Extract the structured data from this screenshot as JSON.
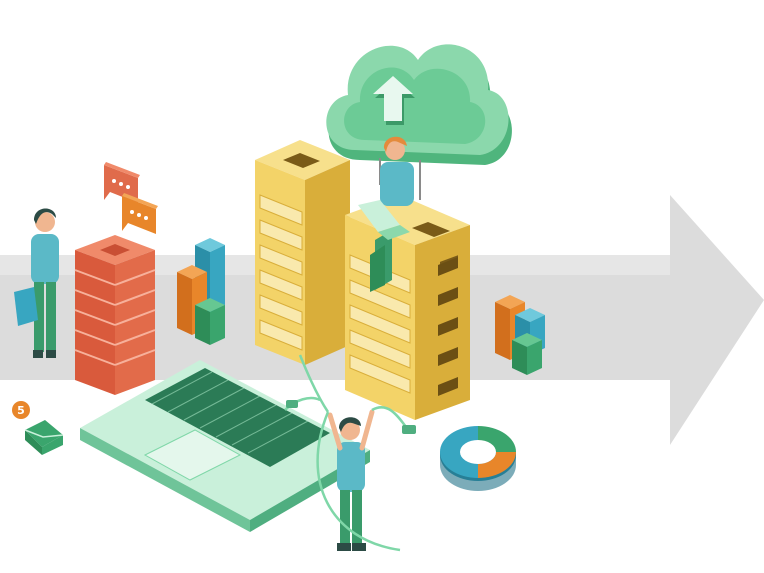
{
  "illustration": {
    "theme": "cloud data transfer isometric illustration",
    "notification_badge": "5",
    "palette": {
      "background": "#ffffff",
      "arrow": "#d9d9d9",
      "cloud": "#5cc38a",
      "cloud_light": "#8bd8ac",
      "server_yellow": "#f3d368",
      "server_yellow_dark": "#d9ae3a",
      "server_red": "#e26b4a",
      "laptop": "#7fd7a8",
      "laptop_keys": "#2b7b56",
      "teal": "#38a6c1",
      "orange": "#e8862a",
      "green": "#3aa56d",
      "skin": "#f0b690",
      "shirt": "#5bb9c7",
      "pants": "#3a9b6b",
      "hair_orange": "#e48b3c",
      "hair_dark": "#2c4b45"
    },
    "icons": [
      "cloud-upload-icon",
      "server-rack-icon",
      "chat-bubble-icon",
      "bar-chart-icon",
      "pie-chart-icon",
      "mail-icon",
      "laptop-icon"
    ]
  }
}
